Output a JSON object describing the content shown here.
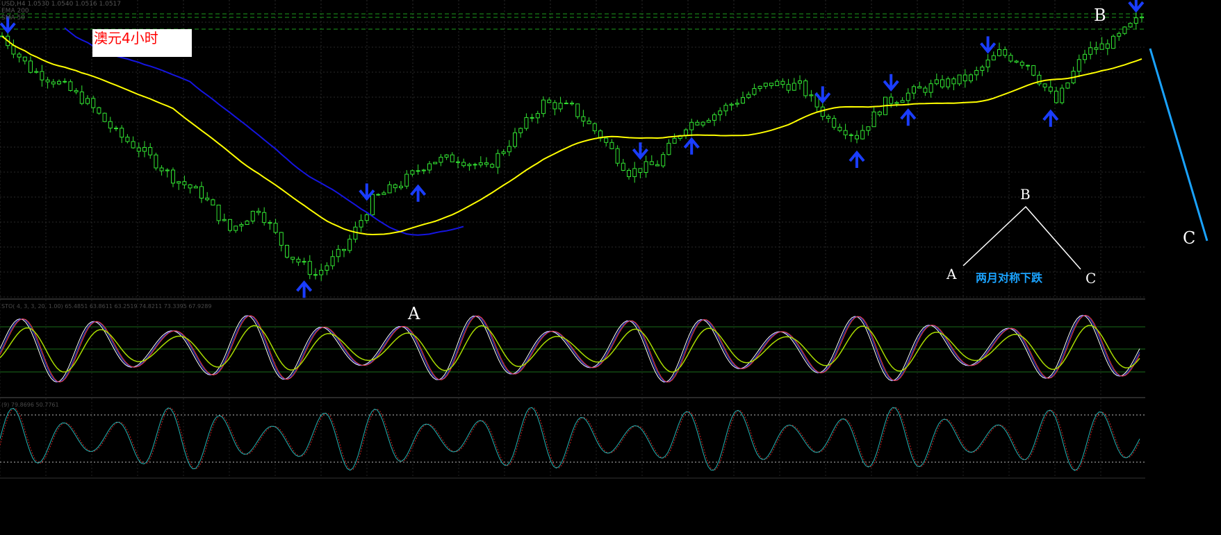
{
  "header": {
    "symbol_line": "USD,H4   1.0530  1.0540  1.0516  1.0517",
    "ind_line_1": "EMA 200",
    "ind_line_2": "SMA 50"
  },
  "title_label": "澳元4小时",
  "annotations": {
    "label_A": "A",
    "label_B_top": "B",
    "label_C_right": "C",
    "pattern_B": "B",
    "pattern_A": "A",
    "pattern_C": "C",
    "pattern_caption": "两月对称下跌"
  },
  "panels": {
    "stoch_label": "STO( 4, 3, 3, 20, 1.00) 65.4851 63.8611 63.2519 74.8211 73.3395 67.9289",
    "rsi_label": "(9)  79.8696 50.7761"
  },
  "colors": {
    "background": "#000000",
    "grid": "#2a2a2a",
    "candles": "#33e633",
    "ema_fast": "#ffff00",
    "ema_slow": "#1515e0",
    "arrow": "#1a3dff",
    "resistance": "#1e9e1e",
    "trend_line": "#1aa3ff",
    "title_text": "#ff0000",
    "caption": "#1aa3ff"
  },
  "chart_data": [
    {
      "type": "candlestick",
      "title": "澳元4小时",
      "series": [
        {
          "x": [
            0,
            5,
            10,
            15,
            20,
            25,
            30,
            35,
            40,
            45,
            50,
            55,
            60,
            65,
            70,
            75,
            80,
            85,
            90,
            95,
            100,
            105,
            110,
            115,
            120,
            125,
            130,
            135,
            140,
            145,
            150,
            155,
            160,
            165,
            170,
            175,
            180,
            185,
            190,
            195,
            200
          ],
          "values": [
            0.92,
            0.8,
            0.75,
            0.68,
            0.57,
            0.5,
            0.41,
            0.35,
            0.22,
            0.3,
            0.14,
            0.06,
            0.15,
            0.33,
            0.39,
            0.47,
            0.48,
            0.44,
            0.56,
            0.68,
            0.66,
            0.56,
            0.43,
            0.46,
            0.6,
            0.64,
            0.7,
            0.75,
            0.74,
            0.62,
            0.56,
            0.68,
            0.72,
            0.75,
            0.77,
            0.86,
            0.82,
            0.68,
            0.86,
            0.9,
            0.99
          ]
        }
      ],
      "arrows_down_at": [
        1,
        64,
        112,
        144,
        156,
        173,
        199
      ],
      "arrows_up_at": [
        53,
        73,
        121,
        150,
        159,
        184
      ]
    }
  ]
}
